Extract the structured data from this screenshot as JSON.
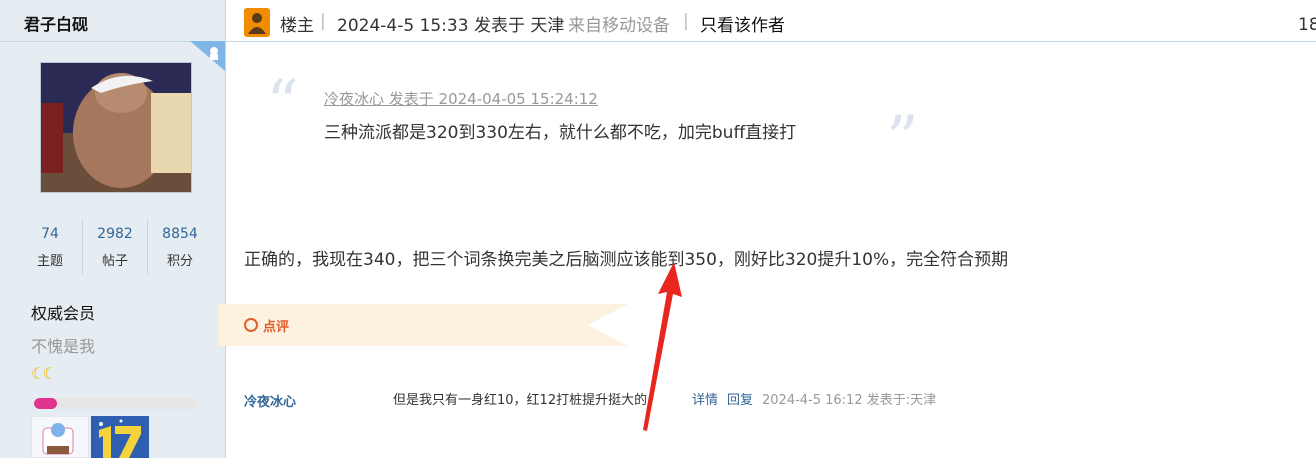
{
  "user": {
    "name": "君子白砚",
    "stats": [
      {
        "value": "74",
        "label": "主题"
      },
      {
        "value": "2982",
        "label": "帖子"
      },
      {
        "value": "8854",
        "label": "积分"
      }
    ],
    "rank_title": "权威会员",
    "rank_subtitle": "不愧是我",
    "rank_icons": "☾☾",
    "level_progress": 0.14
  },
  "post": {
    "op_label": "楼主",
    "posted_at": "2024-4-5 15:33 发表于 天津",
    "from_mobile": "来自移动设备",
    "only_author_link": "只看该作者",
    "floor_number": "18",
    "quote": {
      "meta": "冷夜冰心 发表于 2024-04-05 15:24:12",
      "text": "三种流派都是320到330左右，就什么都不吃，加完buff直接打"
    },
    "body": "正确的，我现在340，把三个词条换完美之后脑测应该能到350，刚好比320提升10%，完全符合预期"
  },
  "comment": {
    "section_label": "点评",
    "author": "冷夜冰心",
    "text": "但是我只有一身红10，红12打桩提升挺大的",
    "details_link": "详情",
    "reply_link": "回复",
    "time": "2024-4-5 16:12 发表于:天津"
  },
  "colors": {
    "sidebar_bg": "#e5edf2",
    "link_blue": "#336699",
    "comment_orange": "#e25c2a",
    "arrow_red": "#e8261f",
    "op_badge": "#f08c00"
  }
}
